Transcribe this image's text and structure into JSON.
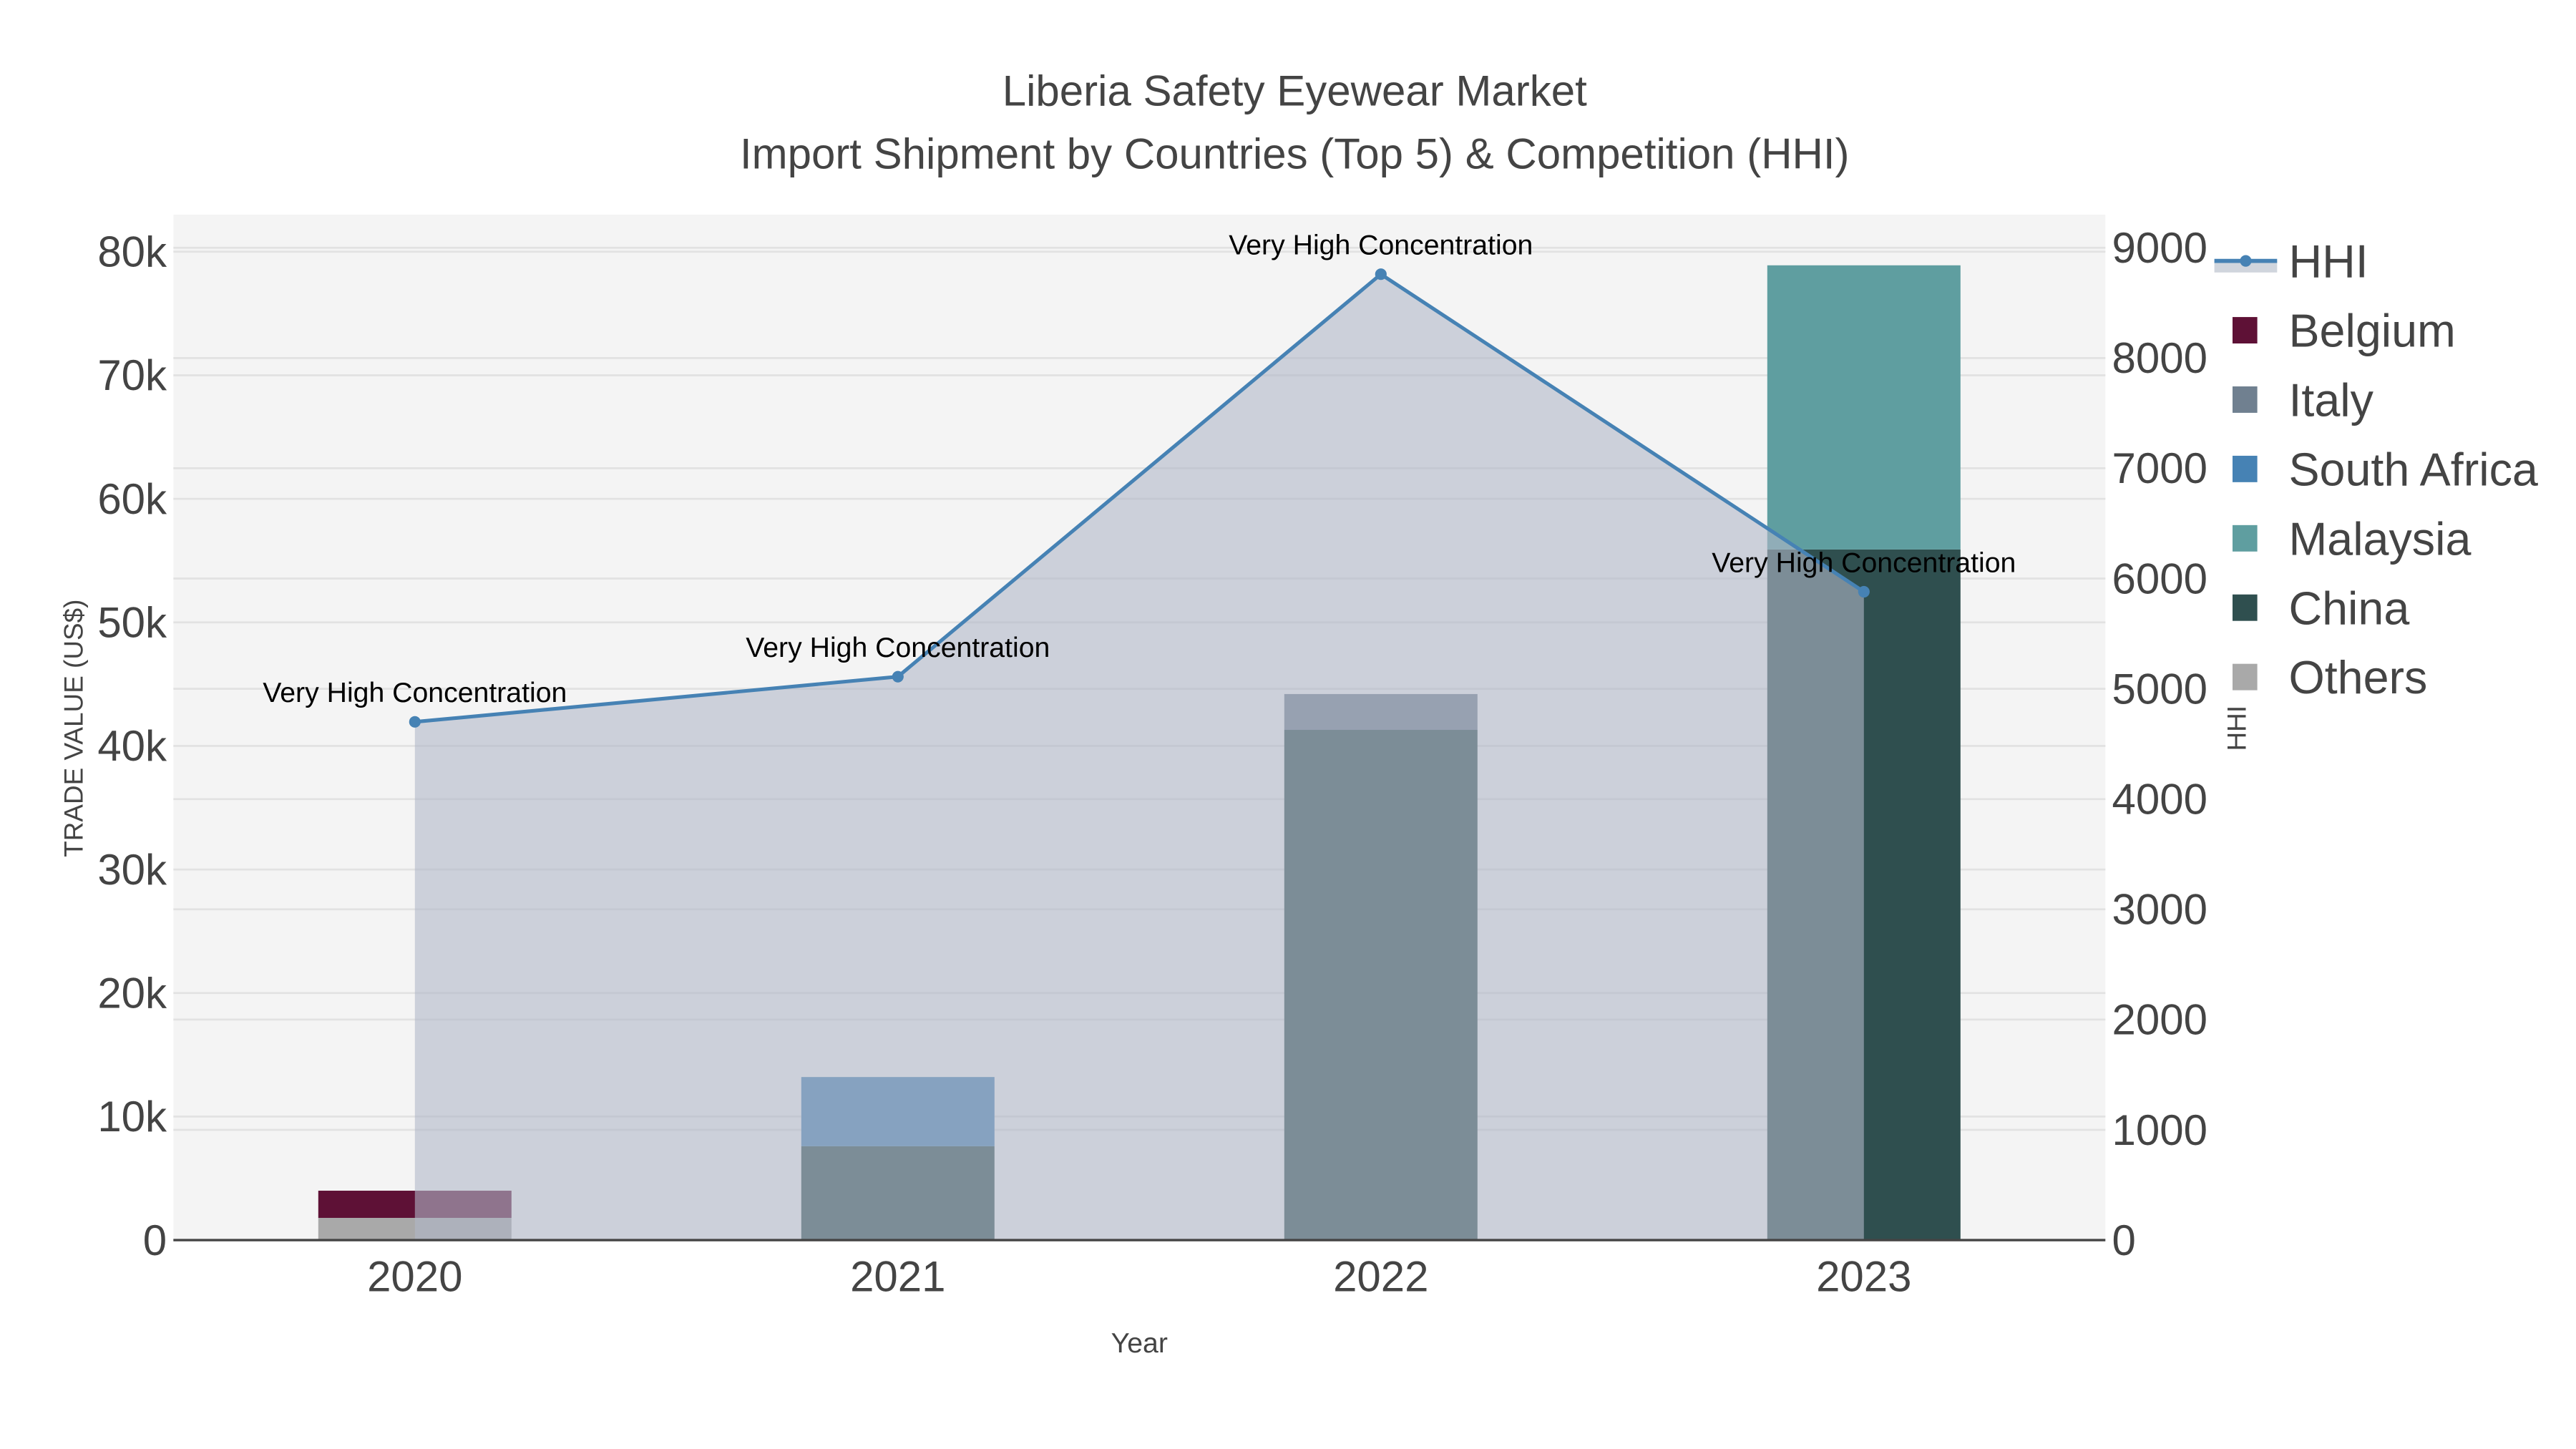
{
  "chart_data": {
    "type": "bar",
    "title": "Liberia Safety Eyewear Market",
    "subtitle": "Import Shipment by Countries (Top 5) & Competition (HHI)",
    "xlabel": "Year",
    "ylabel": "TRADE VALUE (US$)",
    "y2label": "HHI",
    "categories": [
      "2020",
      "2021",
      "2022",
      "2023"
    ],
    "ylim": [
      0,
      83000
    ],
    "y2lim": [
      0,
      9300
    ],
    "yticks": [
      0,
      10000,
      20000,
      30000,
      40000,
      50000,
      60000,
      70000,
      80000
    ],
    "ytick_labels": [
      "0",
      "10k",
      "20k",
      "30k",
      "40k",
      "50k",
      "60k",
      "70k",
      "80k"
    ],
    "y2ticks": [
      0,
      1000,
      2000,
      3000,
      4000,
      5000,
      6000,
      7000,
      8000,
      9000
    ],
    "y2tick_labels": [
      "0",
      "1000",
      "2000",
      "3000",
      "4000",
      "5000",
      "6000",
      "7000",
      "8000",
      "9000"
    ],
    "series": [
      {
        "name": "Others",
        "color": "#a9a9a9",
        "values": [
          1800,
          0,
          0,
          0
        ]
      },
      {
        "name": "China",
        "color": "#2f4f4f",
        "values": [
          0,
          7600,
          41300,
          55900
        ]
      },
      {
        "name": "Malaysia",
        "color": "#5f9ea0",
        "values": [
          0,
          0,
          0,
          23000
        ]
      },
      {
        "name": "South Africa",
        "color": "#4682b4",
        "values": [
          0,
          5600,
          0,
          0
        ]
      },
      {
        "name": "Italy",
        "color": "#708090",
        "values": [
          0,
          0,
          2900,
          0
        ]
      },
      {
        "name": "Belgium",
        "color": "#5e1136",
        "values": [
          2200,
          0,
          0,
          0
        ]
      }
    ],
    "legend_order": [
      "HHI",
      "Belgium",
      "Italy",
      "South Africa",
      "Malaysia",
      "China",
      "Others"
    ],
    "hhi": {
      "name": "HHI",
      "color": "#4682b4",
      "values": [
        4700,
        5110,
        8760,
        5880
      ],
      "annotations": [
        "Very High Concentration",
        "Very High Concentration",
        "Very High Concentration",
        "Very High Concentration"
      ]
    },
    "legend_position": "right",
    "grid": true
  }
}
